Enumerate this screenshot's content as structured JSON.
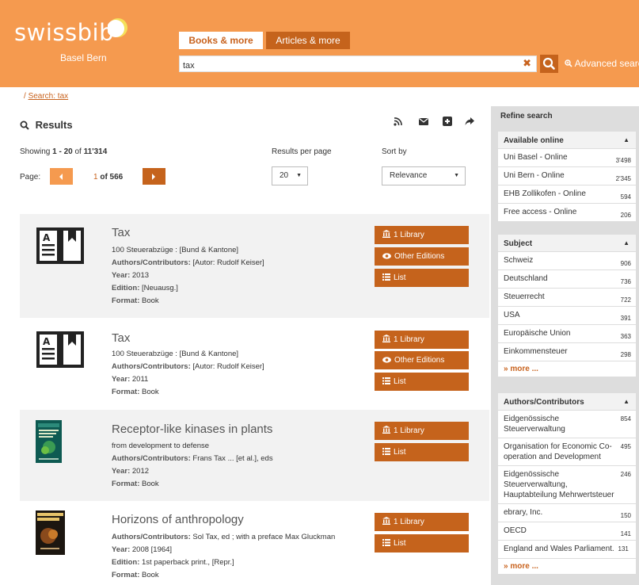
{
  "header": {
    "logo_text": "swissbib",
    "logo_sub": "Basel Bern",
    "tab_books": "Books & more",
    "tab_articles": "Articles & more",
    "search_value": "tax",
    "advanced_search": "Advanced search"
  },
  "breadcrumb": {
    "separator": "/",
    "link": "Search: tax"
  },
  "results": {
    "title": "Results",
    "showing_prefix": "Showing",
    "range": "1 - 20",
    "of": "of",
    "total": "11'314",
    "rpp_label": "Results per page",
    "rpp_value": "20",
    "sort_label": "Sort by",
    "sort_value": "Relevance",
    "page_label": "Page:",
    "page_current": "1",
    "page_of": "of 566"
  },
  "items": [
    {
      "title": "Tax",
      "subtitle": "100 Steuerabzüge : [Bund & Kantone]",
      "authors_label": "Authors/Contributors:",
      "authors": "[Autor: Rudolf Keiser]",
      "year_label": "Year:",
      "year": "2013",
      "edition_label": "Edition:",
      "edition": "[Neuausg.]",
      "format_label": "Format:",
      "format": "Book",
      "btn_library": "1 Library",
      "btn_editions": "Other Editions",
      "btn_list": "List"
    },
    {
      "title": "Tax",
      "subtitle": "100 Steuerabzüge : [Bund & Kantone]",
      "authors_label": "Authors/Contributors:",
      "authors": "[Autor: Rudolf Keiser]",
      "year_label": "Year:",
      "year": "2011",
      "format_label": "Format:",
      "format": "Book",
      "btn_library": "1 Library",
      "btn_editions": "Other Editions",
      "btn_list": "List"
    },
    {
      "title": "Receptor-like kinases in plants",
      "subtitle": "from development to defense",
      "authors_label": "Authors/Contributors:",
      "authors": "Frans Tax ... [et al.], eds",
      "year_label": "Year:",
      "year": "2012",
      "format_label": "Format:",
      "format": "Book",
      "btn_library": "1 Library",
      "btn_list": "List"
    },
    {
      "title": "Horizons of anthropology",
      "authors_label": "Authors/Contributors:",
      "authors": "Sol Tax, ed ; with a preface Max Gluckman",
      "year_label": "Year:",
      "year": "2008 [1964]",
      "edition_label": "Edition:",
      "edition": "1st paperback print., [Repr.]",
      "format_label": "Format:",
      "format": "Book",
      "btn_library": "1 Library",
      "btn_list": "List"
    }
  ],
  "sidebar": {
    "refine": "Refine search",
    "facets": [
      {
        "title": "Available online",
        "items": [
          {
            "label": "Uni Basel - Online",
            "count": "3'498"
          },
          {
            "label": "Uni Bern - Online",
            "count": "2'345"
          },
          {
            "label": "EHB Zollikofen - Online",
            "count": "594"
          },
          {
            "label": "Free access - Online",
            "count": "206"
          }
        ]
      },
      {
        "title": "Subject",
        "items": [
          {
            "label": "Schweiz",
            "count": "906"
          },
          {
            "label": "Deutschland",
            "count": "736"
          },
          {
            "label": "Steuerrecht",
            "count": "722"
          },
          {
            "label": "USA",
            "count": "391"
          },
          {
            "label": "Europäische Union",
            "count": "363"
          },
          {
            "label": "Einkommensteuer",
            "count": "298"
          }
        ],
        "more": "» more ..."
      },
      {
        "title": "Authors/Contributors",
        "items": [
          {
            "label": "Eidgenössische Steuerverwaltung",
            "count": "854"
          },
          {
            "label": "Organisation for Economic Co-operation and Development",
            "count": "495"
          },
          {
            "label": "Eidgenössische Steuerverwaltung, Hauptabteilung Mehrwertsteuer",
            "count": "246"
          },
          {
            "label": "ebrary, Inc.",
            "count": "150"
          },
          {
            "label": "OECD",
            "count": "141"
          },
          {
            "label": "England and Wales Parliament.",
            "count": "131"
          }
        ],
        "more": "» more ..."
      }
    ]
  },
  "colors": {
    "orange": "#f59a4f",
    "dark_orange": "#c5631c",
    "link": "#c8621d"
  }
}
